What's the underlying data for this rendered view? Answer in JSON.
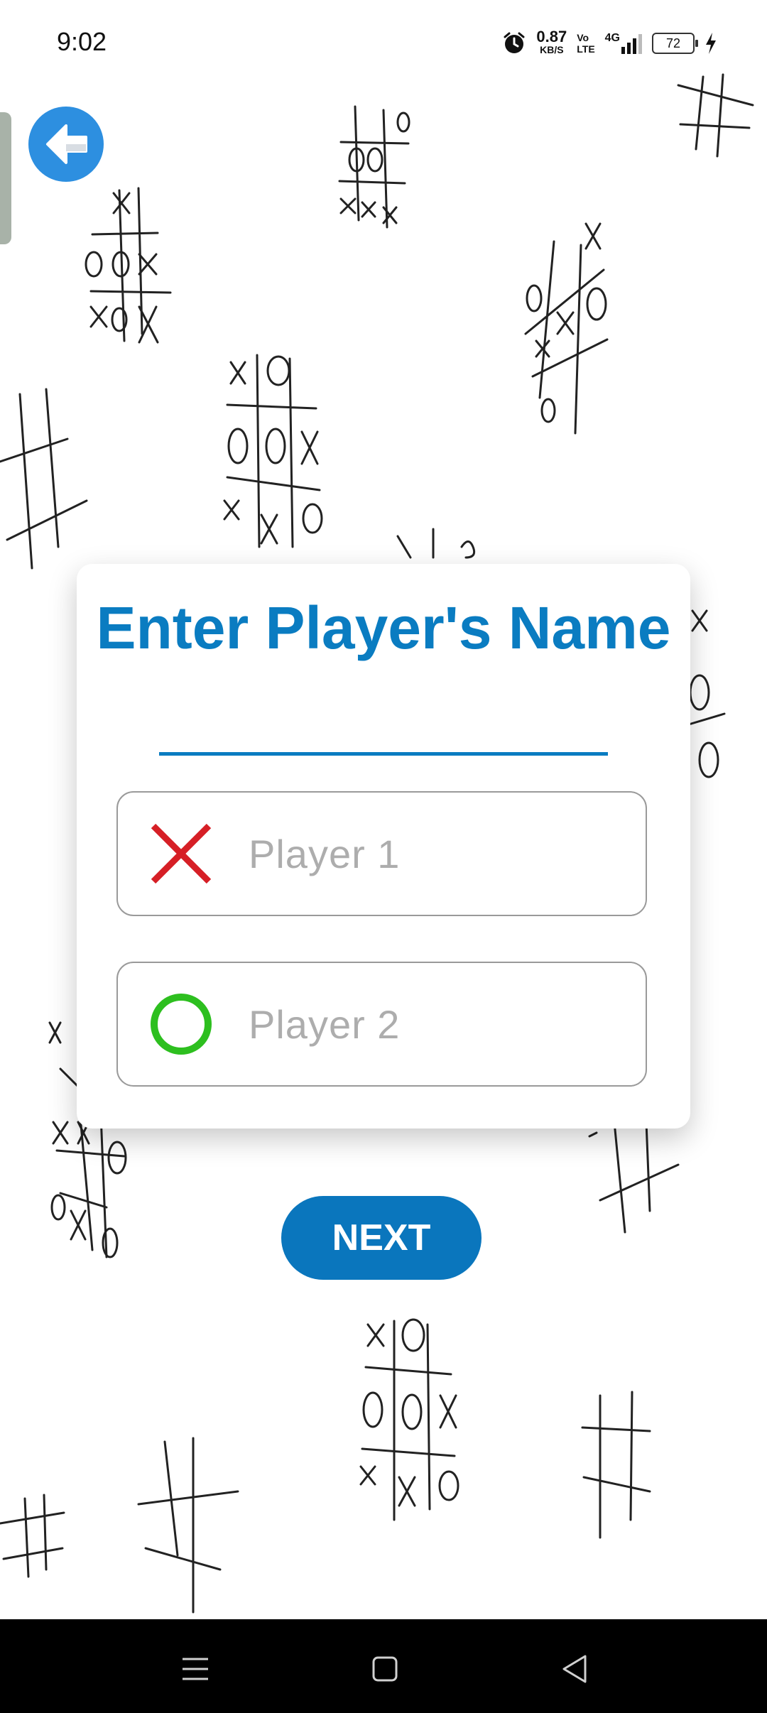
{
  "status_bar": {
    "time": "9:02",
    "net_speed_value": "0.87",
    "net_speed_unit": "KB/S",
    "volte_top": "Vo",
    "volte_bottom": "LTE",
    "network": "4G",
    "battery": "72",
    "icons": [
      "alarm-icon",
      "signal-icon",
      "battery-icon",
      "charging-icon"
    ]
  },
  "header": {
    "back_icon": "back-arrow-icon"
  },
  "dialog": {
    "title": "Enter Player's Name",
    "player1": {
      "placeholder": "Player 1",
      "value": "",
      "icon": "x-mark-icon"
    },
    "player2": {
      "placeholder": "Player 2",
      "value": "",
      "icon": "o-mark-icon"
    }
  },
  "next_button": {
    "label": "NEXT"
  },
  "nav": {
    "icons": [
      "menu-icon",
      "home-icon",
      "back-icon"
    ]
  },
  "colors": {
    "accent": "#0a7cc1",
    "x_mark": "#d61f26",
    "o_mark": "#2dbf1f",
    "back_button": "#2d8fe0"
  }
}
